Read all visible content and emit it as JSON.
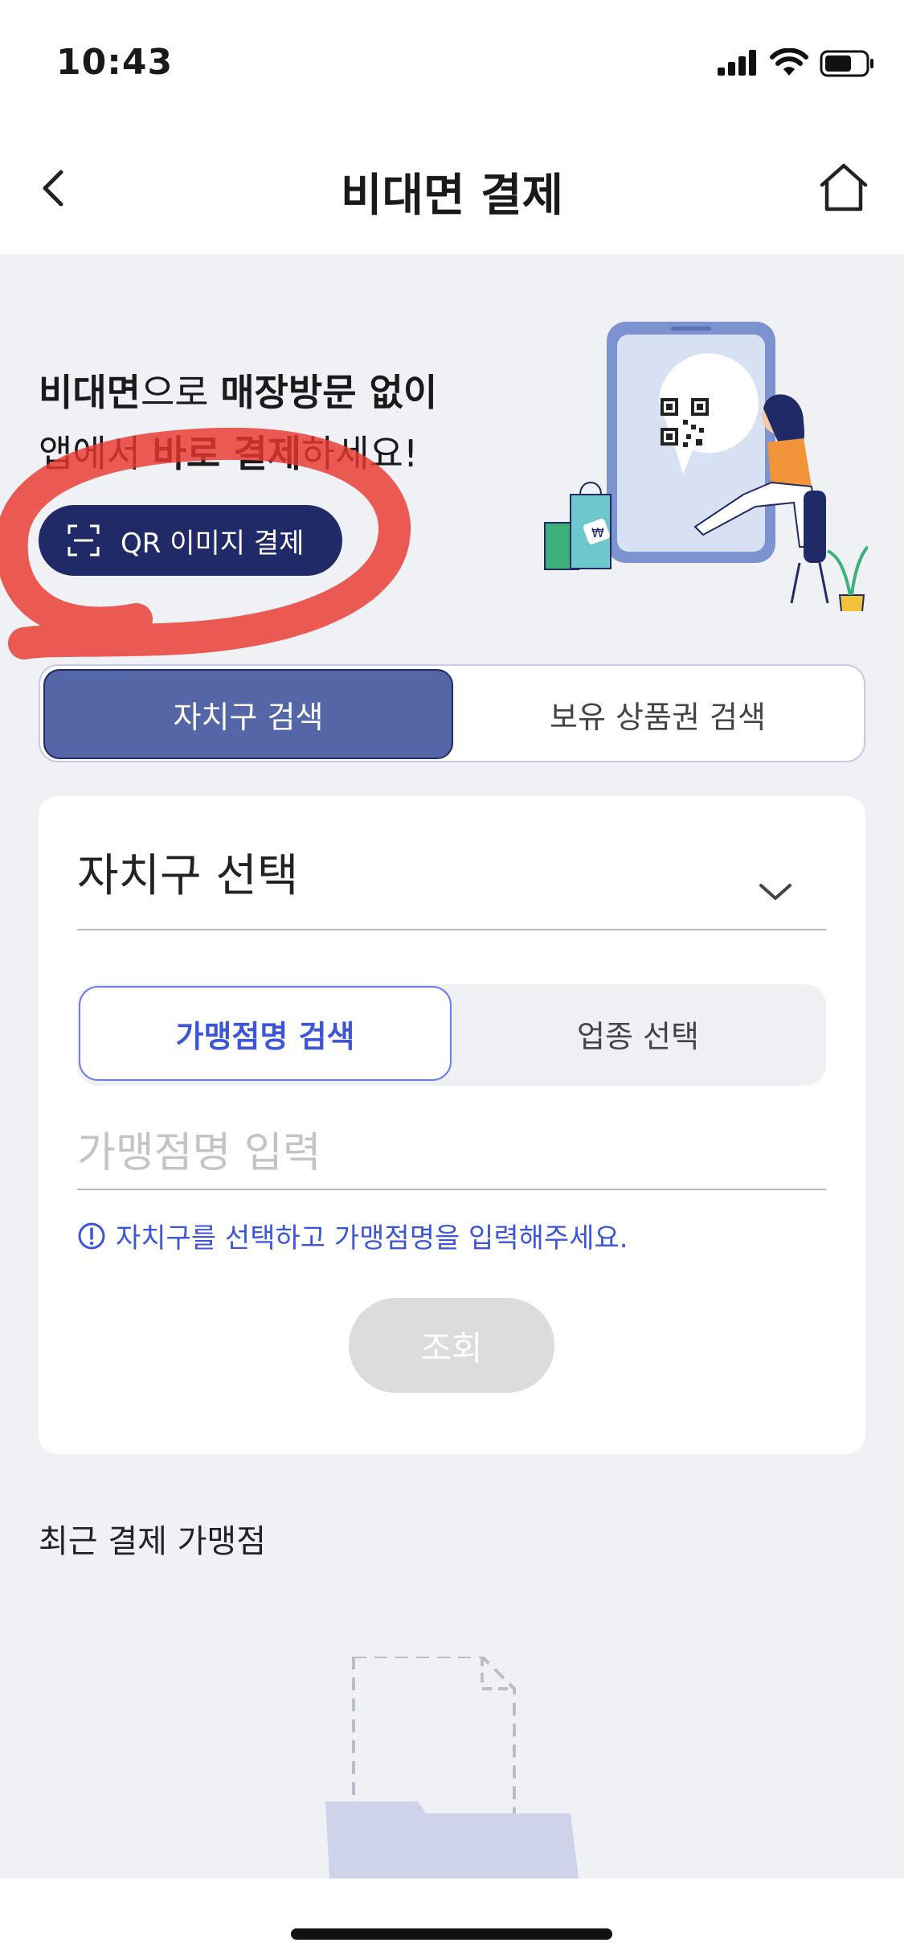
{
  "status_bar": {
    "time": "10:43"
  },
  "header": {
    "title": "비대면 결제"
  },
  "hero": {
    "line1_bold_a": "비대면",
    "line1_normal": "으로 ",
    "line1_bold_b": "매장방문 없이",
    "line2_normal_a": "앱에서 ",
    "line2_bold": "바로 결제",
    "line2_normal_b": "하세요!",
    "qr_button_label": "QR 이미지 결제"
  },
  "search_mode_tabs": {
    "active": "자치구 검색",
    "inactive": "보유 상품권 검색"
  },
  "district_select": {
    "selected_text": "자치구 선택"
  },
  "merchant_tabs": {
    "active": "가맹점명 검색",
    "inactive": "업종 선택"
  },
  "merchant_input": {
    "placeholder": "가맹점명 입력",
    "value": ""
  },
  "hint_text": "자치구를 선택하고 가맹점명을 입력해주세요.",
  "search_button_label": "조회",
  "recent": {
    "title": "최근 결제 가맹점"
  },
  "colors": {
    "navy": "#1f2a66",
    "active_tab": "#5566a6",
    "accent_blue": "#3d55d8",
    "annotation_red": "#e8382e"
  }
}
